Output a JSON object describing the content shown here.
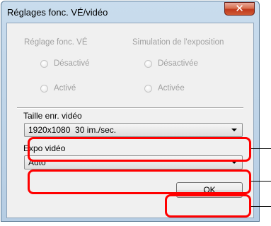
{
  "window": {
    "title": "Réglages fonc. VÉ/vidéo",
    "close_icon": "close-icon"
  },
  "live_view_group": {
    "title": "Réglage fonc. VÉ",
    "options": [
      {
        "label": "Désactivé",
        "selected": false,
        "enabled": false
      },
      {
        "label": "Activé",
        "selected": false,
        "enabled": false
      }
    ]
  },
  "exposure_sim_group": {
    "title": "Simulation de l'exposition",
    "options": [
      {
        "label": "Désactivée",
        "selected": false,
        "enabled": false
      },
      {
        "label": "Activée",
        "selected": false,
        "enabled": false
      }
    ]
  },
  "movie_size": {
    "label": "Taille enr. vidéo",
    "value": "1920x1080  30 im./sec."
  },
  "movie_exposure": {
    "label": "Expo vidéo",
    "value": "Auto"
  },
  "ok_button": {
    "label": "OK"
  },
  "colors": {
    "highlight": "#ff0000",
    "disabled_text": "#a0a0a0",
    "window_frame": "#b6cde3"
  }
}
